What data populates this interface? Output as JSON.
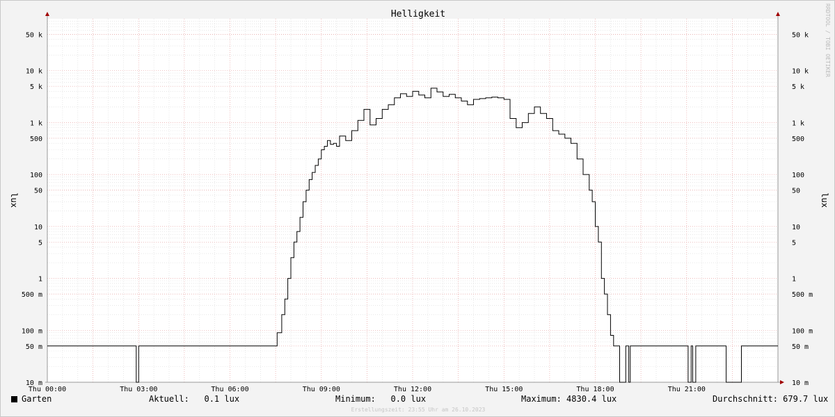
{
  "chart_data": {
    "type": "line",
    "title": "Helligkeit",
    "ylabel": "lux",
    "yscale": "log",
    "ylim": [
      0.01,
      100000
    ],
    "xlim": [
      0,
      24
    ],
    "x_ticks": [
      0,
      3,
      6,
      9,
      12,
      15,
      18,
      21
    ],
    "x_tick_labels": [
      "Thu 00:00",
      "Thu 03:00",
      "Thu 06:00",
      "Thu 09:00",
      "Thu 12:00",
      "Thu 15:00",
      "Thu 18:00",
      "Thu 21:00"
    ],
    "y_ticks": [
      0.01,
      0.05,
      0.1,
      0.5,
      1,
      5,
      10,
      50,
      100,
      500,
      1000,
      5000,
      10000,
      50000
    ],
    "y_tick_labels": [
      "10 m",
      "50 m",
      "100 m",
      "500 m",
      "1",
      "5",
      "10",
      "50",
      "100",
      "500",
      "1 k",
      "5 k",
      "10 k",
      "50 k"
    ],
    "grid": true,
    "series": [
      {
        "name": "Garten",
        "color": "#000000",
        "x": [
          0,
          2.9,
          2.92,
          2.97,
          3.0,
          7.45,
          7.55,
          7.7,
          7.8,
          7.9,
          8.0,
          8.1,
          8.2,
          8.3,
          8.4,
          8.5,
          8.6,
          8.7,
          8.8,
          8.9,
          9.0,
          9.1,
          9.2,
          9.3,
          9.4,
          9.5,
          9.6,
          9.8,
          10.0,
          10.2,
          10.4,
          10.6,
          10.8,
          11.0,
          11.2,
          11.4,
          11.6,
          11.8,
          12.0,
          12.2,
          12.4,
          12.6,
          12.8,
          13.0,
          13.2,
          13.4,
          13.6,
          13.8,
          14.0,
          14.2,
          14.4,
          14.6,
          14.8,
          15.0,
          15.2,
          15.4,
          15.6,
          15.8,
          16.0,
          16.2,
          16.4,
          16.6,
          16.8,
          17.0,
          17.2,
          17.4,
          17.6,
          17.8,
          17.9,
          18.0,
          18.1,
          18.2,
          18.3,
          18.4,
          18.5,
          18.6,
          18.7,
          18.8,
          18.9,
          19.0,
          19.05,
          19.1,
          19.15,
          19.2,
          19.3,
          19.35,
          19.4,
          19.8,
          21.0,
          21.05,
          21.15,
          21.2,
          21.3,
          21.4,
          21.45,
          21.6,
          21.9,
          22.3,
          22.7,
          22.8,
          24
        ],
        "values": [
          0.05,
          0.05,
          0.01,
          0.01,
          0.05,
          0.05,
          0.09,
          0.2,
          0.4,
          1,
          2.5,
          5,
          8,
          15,
          30,
          50,
          80,
          110,
          150,
          200,
          300,
          350,
          450,
          380,
          400,
          350,
          550,
          450,
          700,
          1100,
          1800,
          900,
          1200,
          1800,
          2200,
          3000,
          3600,
          3200,
          4000,
          3400,
          3000,
          4600,
          3900,
          3200,
          3500,
          3000,
          2600,
          2200,
          2800,
          2900,
          3000,
          3100,
          3000,
          2800,
          1200,
          800,
          1000,
          1500,
          2000,
          1500,
          1200,
          700,
          600,
          500,
          400,
          200,
          100,
          50,
          30,
          10,
          5,
          1,
          0.5,
          0.2,
          0.08,
          0.05,
          0.05,
          0.01,
          0.01,
          0.05,
          0.05,
          0.01,
          0.05,
          0.05,
          0.05,
          0.05,
          0.05,
          0.05,
          0.05,
          0.01,
          0.05,
          0.01,
          0.05,
          0.05,
          0.05,
          0.05,
          0.05,
          0.01,
          0.01,
          0.05,
          0.05
        ]
      }
    ]
  },
  "watermark": "RRDTOOL / TOBI OETIKER",
  "legend": {
    "series_name": "Garten",
    "current": "Aktuell:   0.1 lux",
    "minimum": "Minimum:   0.0 lux",
    "maximum": "Maximum: 4830.4 lux",
    "average": "Durchschnitt: 679.7 lux"
  },
  "footer": "Erstellungszeit: 23:55 Uhr am 26.10.2023"
}
